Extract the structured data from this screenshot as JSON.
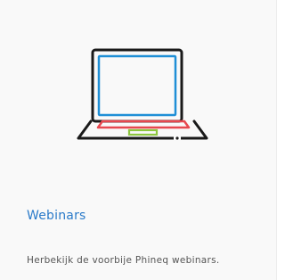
{
  "card": {
    "title": "Webinars",
    "description": "Herbekijk de voorbije Phineq webinars.",
    "icon": "laptop-icon"
  },
  "colors": {
    "title": "#2a7ac9",
    "outline": "#1a1a1a",
    "screen": "#1f8fd6",
    "keyboard": "#e8484f",
    "trackpad": "#8dc63f"
  }
}
